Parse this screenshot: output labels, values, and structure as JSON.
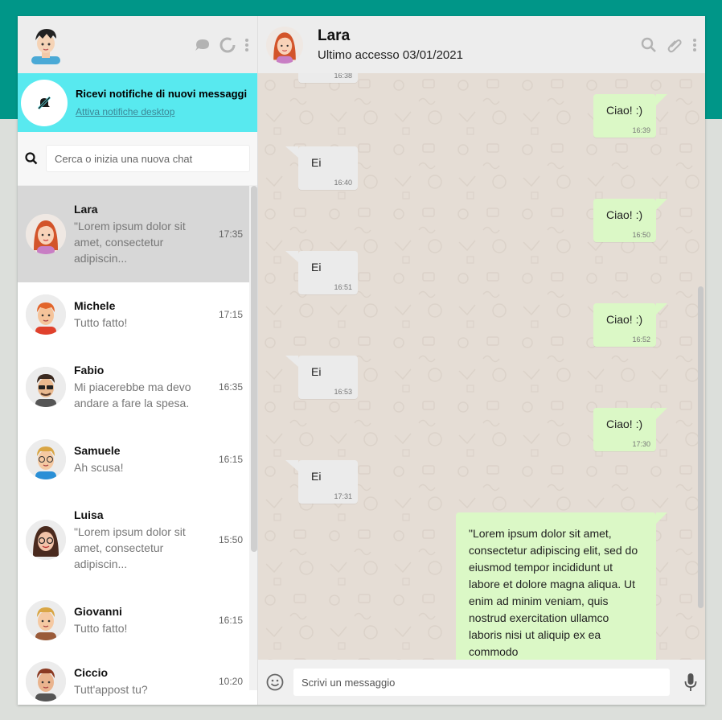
{
  "sidebar": {
    "notification": {
      "title": "Ricevi notifiche di nuovi messaggi",
      "link": "Attiva notifiche desktop"
    },
    "search": {
      "placeholder": "Cerca o inizia una nuova chat"
    },
    "chats": [
      {
        "name": "Lara",
        "preview": "\"Lorem ipsum dolor sit amet, consectetur adipiscin...",
        "time": "17:35",
        "active": true
      },
      {
        "name": "Michele",
        "preview": "Tutto fatto!",
        "time": "17:15"
      },
      {
        "name": "Fabio",
        "preview": "Mi piacerebbe ma devo andare a fare la spesa.",
        "time": "16:35"
      },
      {
        "name": "Samuele",
        "preview": "Ah scusa!",
        "time": "16:15"
      },
      {
        "name": "Luisa",
        "preview": "\"Lorem ipsum dolor sit amet, consectetur adipiscin...",
        "time": "15:50"
      },
      {
        "name": "Giovanni",
        "preview": "Tutto fatto!",
        "time": "16:15"
      },
      {
        "name": "Ciccio",
        "preview": "Tutt'appost tu?",
        "time": "10:20"
      }
    ]
  },
  "conversation": {
    "contact_name": "Lara",
    "last_seen": "Ultimo accesso 03/01/2021",
    "messages": [
      {
        "dir": "in",
        "text": "",
        "time": "16:38"
      },
      {
        "dir": "out",
        "text": "Ciao! :)",
        "time": "16:39"
      },
      {
        "dir": "in",
        "text": "Ei",
        "time": "16:40"
      },
      {
        "dir": "out",
        "text": "Ciao! :)",
        "time": "16:50"
      },
      {
        "dir": "in",
        "text": "Ei",
        "time": "16:51"
      },
      {
        "dir": "out",
        "text": "Ciao! :)",
        "time": "16:52"
      },
      {
        "dir": "in",
        "text": "Ei",
        "time": "16:53"
      },
      {
        "dir": "out",
        "text": "Ciao! :)",
        "time": "17:30"
      },
      {
        "dir": "in",
        "text": "Ei",
        "time": "17:31"
      },
      {
        "dir": "out",
        "text": "\"Lorem ipsum dolor sit amet, consectetur adipiscing elit, sed do eiusmod tempor incididunt ut labore et dolore magna aliqua. Ut enim ad minim veniam, quis nostrud exercitation ullamco laboris nisi ut aliquip ex ea commodo",
        "time": ""
      }
    ]
  },
  "composer": {
    "placeholder": "Scrivi un messaggio"
  },
  "colors": {
    "teal": "#009688",
    "notif_bg": "#58e9ef",
    "outgoing": "#dbf8c6",
    "incoming": "#ebebeb",
    "chat_bg": "#e5ddd5"
  },
  "icons": [
    "chat-bubble-icon",
    "status-ring-icon",
    "kebab-menu-icon",
    "notifications-off-icon",
    "search-icon",
    "paperclip-icon",
    "emoji-icon",
    "microphone-icon"
  ]
}
